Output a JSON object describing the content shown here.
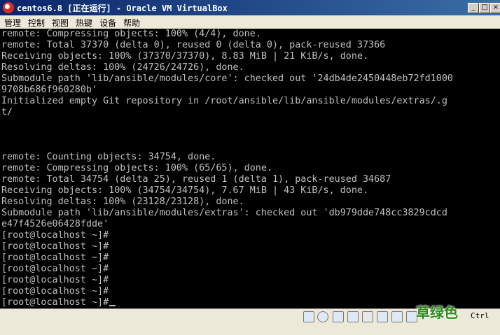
{
  "window": {
    "title": "centos6.8 [正在运行] - Oracle VM VirtualBox",
    "minimize": "_",
    "maximize": "□",
    "close": "×"
  },
  "menu": [
    "管理",
    "控制",
    "视图",
    "热键",
    "设备",
    "帮助"
  ],
  "terminal_lines": [
    "remote: Compressing objects: 100% (4/4), done.",
    "remote: Total 37370 (delta 0), reused 0 (delta 0), pack-reused 37366",
    "Receiving objects: 100% (37370/37370), 8.83 MiB | 21 KiB/s, done.",
    "Resolving deltas: 100% (24726/24726), done.",
    "Submodule path 'lib/ansible/modules/core': checked out '24db4de2450448eb72fd1000",
    "9708b686f960280b'",
    "Initialized empty Git repository in /root/ansible/lib/ansible/modules/extras/.g",
    "t/",
    "",
    "",
    "",
    "remote: Counting objects: 34754, done.",
    "remote: Compressing objects: 100% (65/65), done.",
    "remote: Total 34754 (delta 25), reused 1 (delta 1), pack-reused 34687",
    "Receiving objects: 100% (34754/34754), 7.67 MiB | 43 KiB/s, done.",
    "Resolving deltas: 100% (23128/23128), done.",
    "Submodule path 'lib/ansible/modules/extras': checked out 'db979dde748cc3829cdcd",
    "e47f4526e06428fdde'",
    "[root@localhost ~]#",
    "[root@localhost ~]#",
    "[root@localhost ~]#",
    "[root@localhost ~]#",
    "[root@localhost ~]#",
    "[root@localhost ~]#",
    "[root@localhost ~]#"
  ],
  "status": {
    "icons": [
      "cd-icon",
      "audio-icon",
      "usb-icon",
      "shared-folders-icon",
      "display-icon",
      "network-icon",
      "capture-icon",
      "mouse-integration-icon"
    ],
    "host_key": "Ctrl"
  },
  "watermark": "草绿色"
}
